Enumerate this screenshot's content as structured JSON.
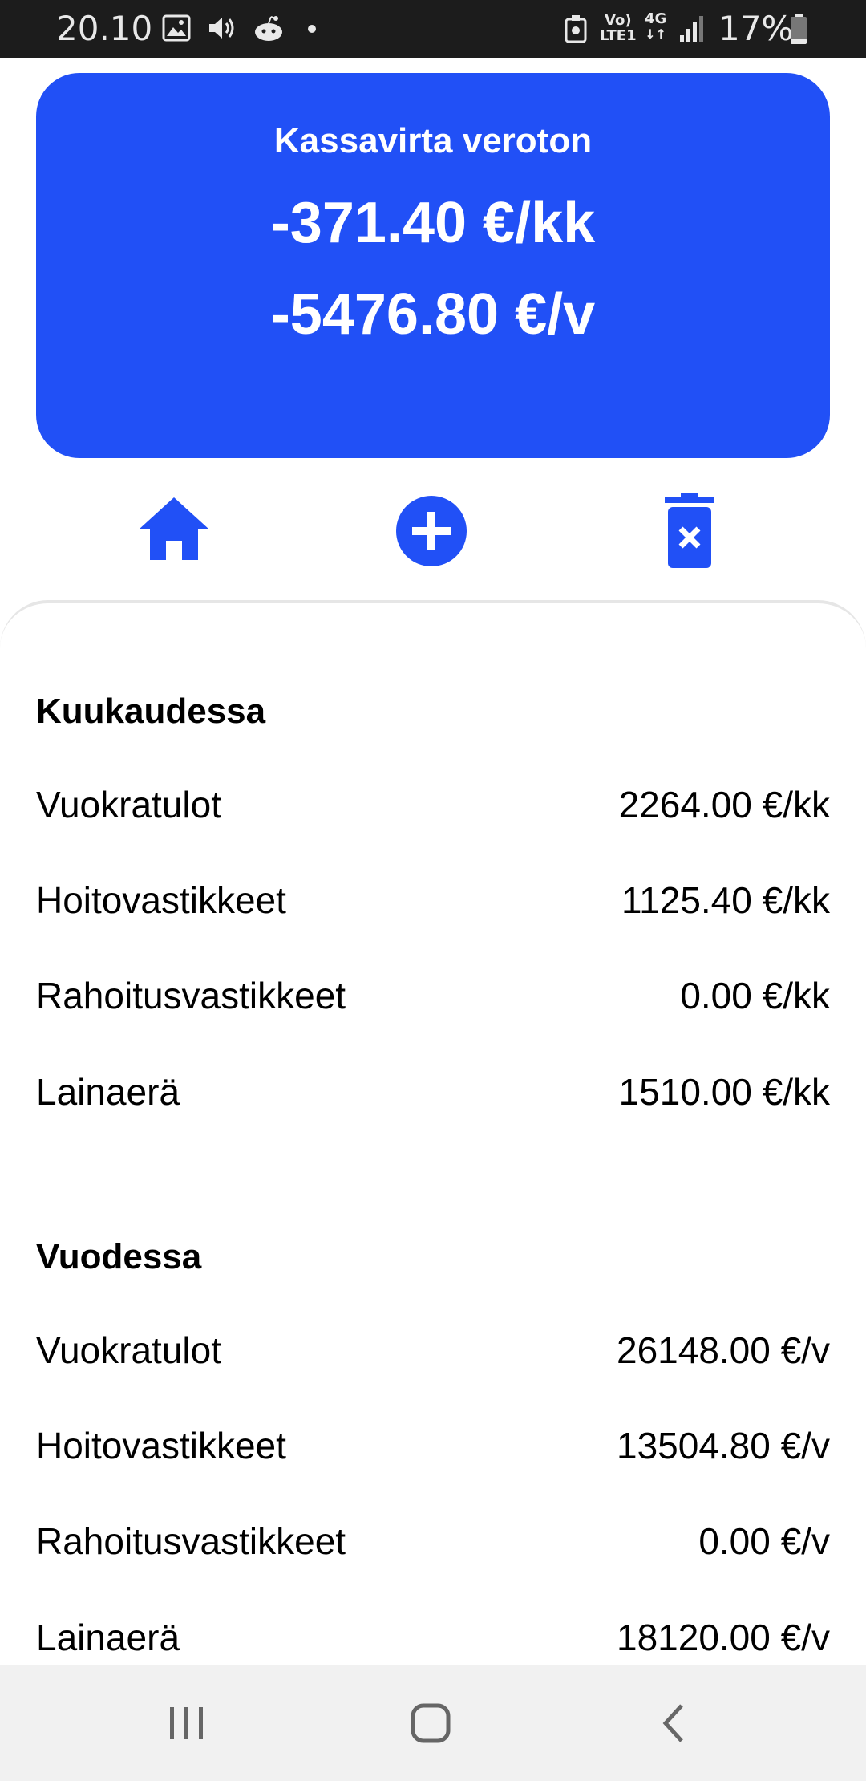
{
  "status_bar": {
    "time": "20.10",
    "battery": "17%",
    "net_top": "Vo)",
    "net_bottom": "LTE1",
    "net_type": "4G",
    "icons": [
      "image-icon",
      "volume-icon",
      "reddit-icon",
      "notification-dot-icon",
      "nfc-icon",
      "volte-icon",
      "4g-icon",
      "signal-icon",
      "battery-icon"
    ]
  },
  "summary": {
    "title": "Kassavirta veroton",
    "monthly": "-371.40 €/kk",
    "yearly": "-5476.80 €/v",
    "color": "#2150f6"
  },
  "actions": {
    "icons": [
      "home-icon",
      "add-circle-icon",
      "delete-icon"
    ],
    "color": "#2150f6"
  },
  "monthly": {
    "title": "Kuukaudessa",
    "rows": [
      {
        "label": "Vuokratulot",
        "value": "2264.00 €/kk"
      },
      {
        "label": "Hoitovastikkeet",
        "value": "1125.40 €/kk"
      },
      {
        "label": "Rahoitusvastikkeet",
        "value": "0.00 €/kk"
      },
      {
        "label": "Lainaerä",
        "value": "1510.00 €/kk"
      }
    ]
  },
  "yearly": {
    "title": "Vuodessa",
    "rows": [
      {
        "label": "Vuokratulot",
        "value": "26148.00 €/v"
      },
      {
        "label": "Hoitovastikkeet",
        "value": "13504.80 €/v"
      },
      {
        "label": "Rahoitusvastikkeet",
        "value": "0.00 €/v"
      },
      {
        "label": "Lainaerä",
        "value": "18120.00 €/v"
      }
    ]
  },
  "nav": {
    "icons": [
      "recent-apps-icon",
      "home-nav-icon",
      "back-icon"
    ]
  }
}
